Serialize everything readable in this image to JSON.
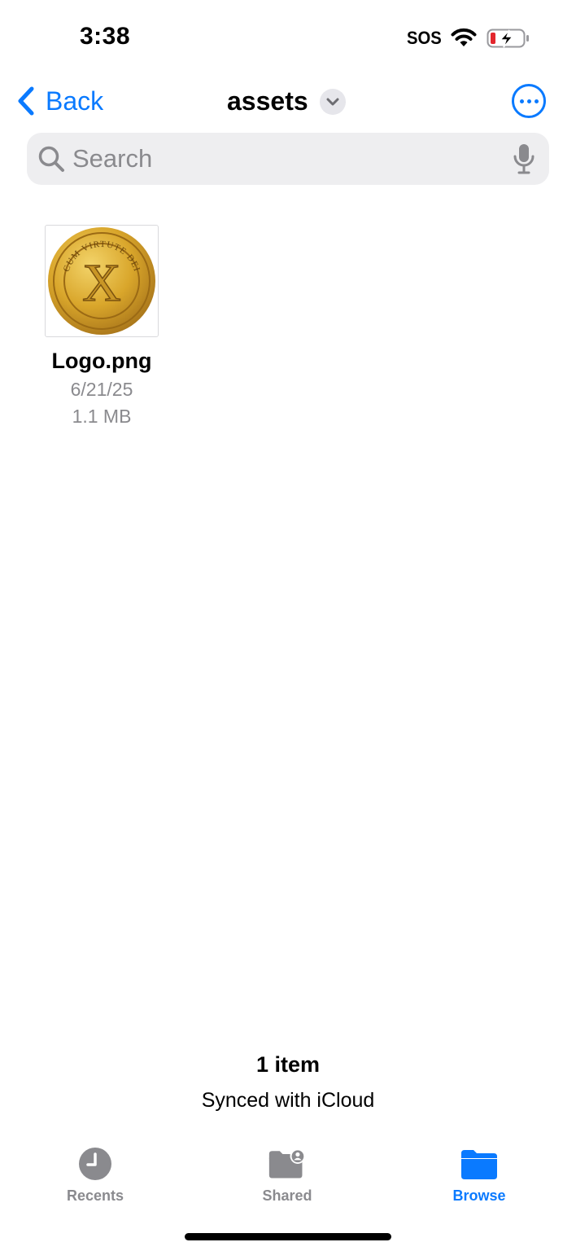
{
  "status_bar": {
    "time": "3:38",
    "carrier_text": "SOS",
    "battery_color": "#e3262d",
    "icons": [
      "wifi-icon",
      "battery-charging-icon"
    ]
  },
  "nav": {
    "back_label": "Back",
    "title": "assets",
    "accent": "#0a7aff",
    "icons": [
      "chevron-left-icon",
      "chevron-down-icon",
      "more-icon"
    ]
  },
  "search": {
    "placeholder": "Search",
    "value": "",
    "icons": [
      "search-icon",
      "mic-icon"
    ]
  },
  "files": [
    {
      "name": "Logo.png",
      "date": "6/21/25",
      "size": "1.1 MB",
      "thumbnail_icon": "gold-coin-logo-icon",
      "thumbnail_text": "CUM VIRTUTE DEI",
      "thumbnail_letter": "X"
    }
  ],
  "footer": {
    "item_count": "1 item",
    "sync_status": "Synced with iCloud"
  },
  "tabs": [
    {
      "label": "Recents",
      "icon": "clock-icon",
      "active": false
    },
    {
      "label": "Shared",
      "icon": "shared-folder-icon",
      "active": false
    },
    {
      "label": "Browse",
      "icon": "folder-icon",
      "active": true
    }
  ]
}
